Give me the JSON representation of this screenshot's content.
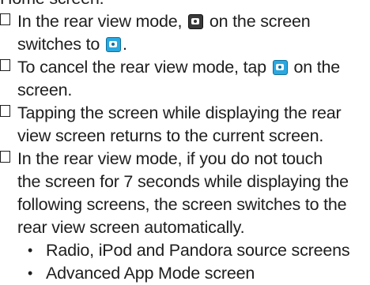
{
  "header_fragment": "Home screen.",
  "items": [
    {
      "line1_before": "In the rear view mode,",
      "icon_off": "camera-off-icon",
      "line1_after": "on the screen",
      "line2_before": "switches to",
      "icon_on": "camera-on-icon",
      "line2_after": "."
    },
    {
      "line1_before": "To cancel the rear view mode, tap",
      "icon_on": "camera-on-icon",
      "line1_after": "on the",
      "line2": "screen."
    },
    {
      "line1": "Tapping the screen while displaying the rear",
      "line2": "view screen returns to the current screen."
    },
    {
      "line1": "In the rear view mode, if you do not touch",
      "line2": "the screen for 7 seconds while displaying the",
      "line3": "following screens, the screen switches to the",
      "line4": "rear view screen automatically."
    }
  ],
  "sub_items": [
    "Radio, iPod and Pandora source screens",
    "Advanced App Mode screen"
  ],
  "colors": {
    "text": "#1e1e1e",
    "icon_active": "#2aa8e0",
    "icon_inactive": "#3a3a3a"
  }
}
